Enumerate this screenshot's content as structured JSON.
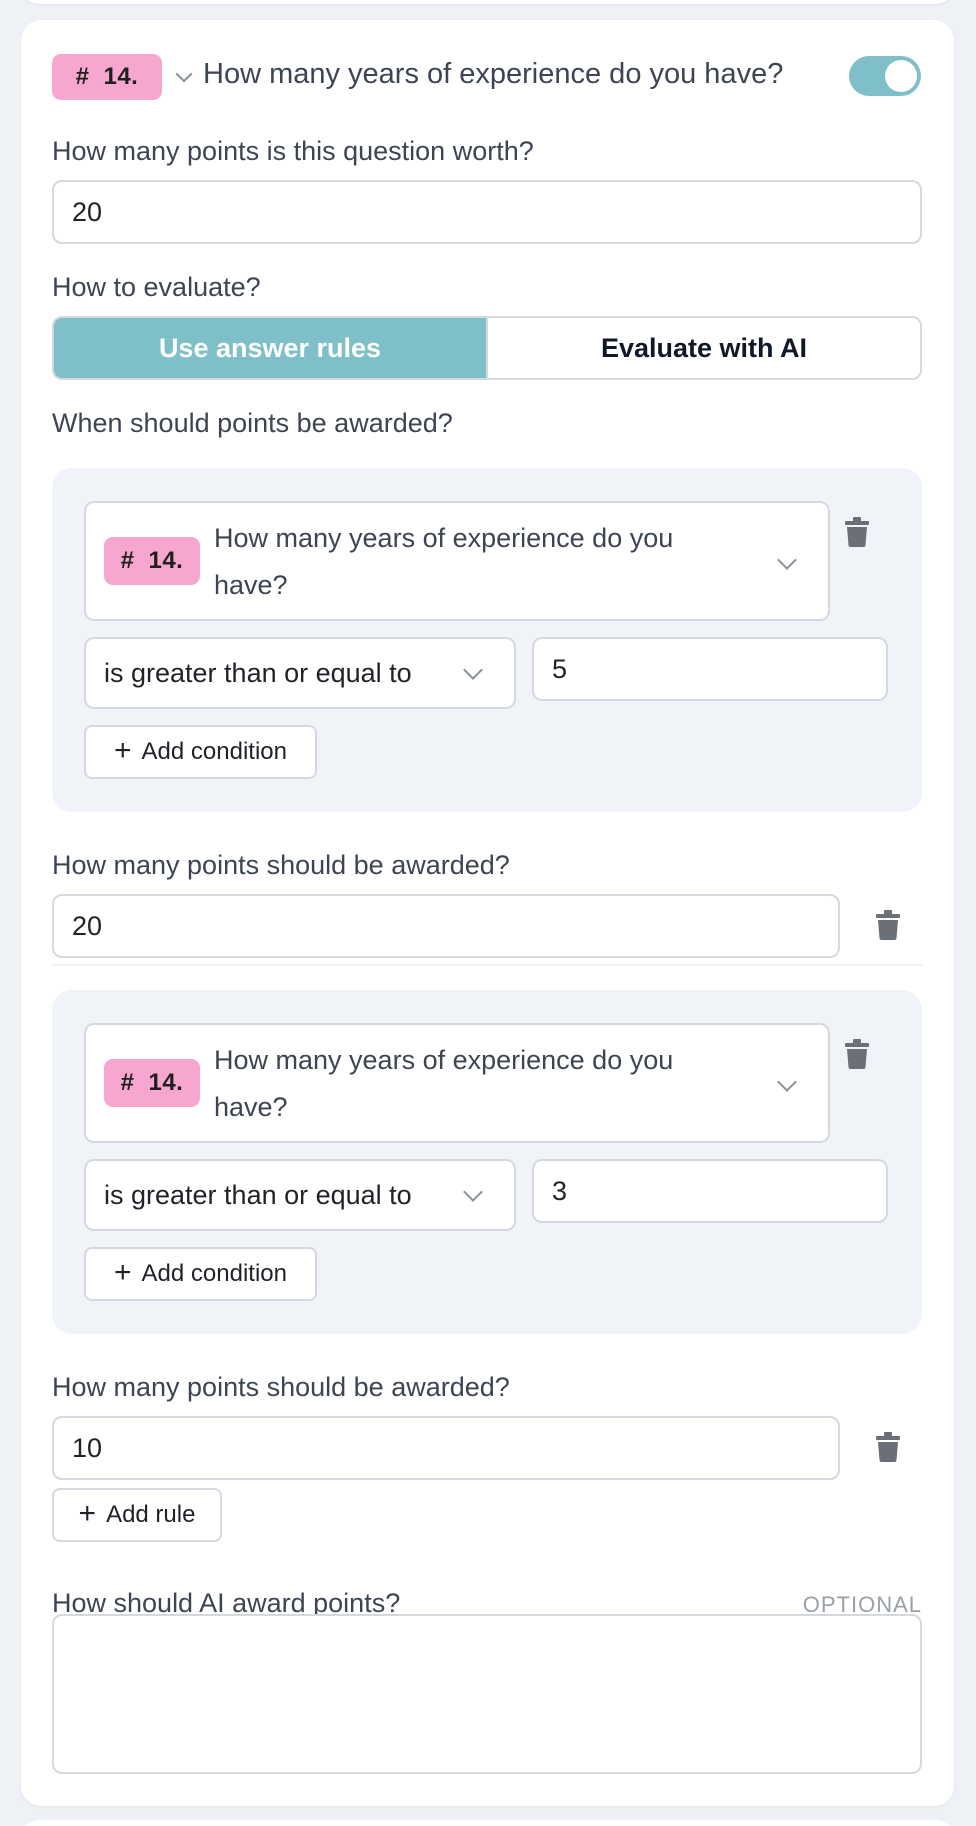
{
  "question": {
    "number_tag": "14.",
    "hash": "#",
    "title": "How many years of experience do you have?",
    "enabled": true
  },
  "points": {
    "label": "How many points is this question worth?",
    "value": "20"
  },
  "evaluate": {
    "label": "How to evaluate?",
    "options": [
      "Use answer rules",
      "Evaluate with AI"
    ],
    "selected": "Use answer rules"
  },
  "award_section_label": "When should points be awarded?",
  "rules": [
    {
      "question_tag": "14.",
      "question_text": "How many years of experience do you have?",
      "operator": "is greater than or equal to",
      "value": "5",
      "add_condition_label": "Add condition",
      "points_label": "How many points should be awarded?",
      "points_value": "20"
    },
    {
      "question_tag": "14.",
      "question_text": "How many years of experience do you have?",
      "operator": "is greater than or equal to",
      "value": "3",
      "add_condition_label": "Add condition",
      "points_label": "How many points should be awarded?",
      "points_value": "10"
    }
  ],
  "add_rule_label": "Add rule",
  "ai": {
    "label": "How should AI award points?",
    "optional": "OPTIONAL",
    "value": ""
  },
  "colors": {
    "accent": "#7fc0c8",
    "tag": "#f7a6cf",
    "rule_bg": "#f0f3f7"
  }
}
